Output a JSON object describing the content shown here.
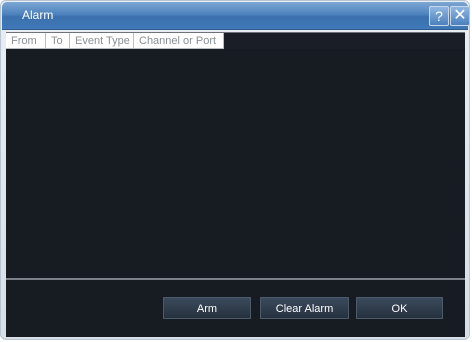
{
  "window": {
    "title": "Alarm",
    "help_glyph": "?",
    "close_glyph": "✕"
  },
  "table": {
    "columns": [
      "From",
      "To",
      "Event Type",
      "Channel or Port"
    ],
    "rows": []
  },
  "buttons": {
    "arm": "Arm",
    "clear_alarm": "Clear Alarm",
    "ok": "OK"
  },
  "icons": {
    "help": "help-icon",
    "close": "close-icon"
  }
}
